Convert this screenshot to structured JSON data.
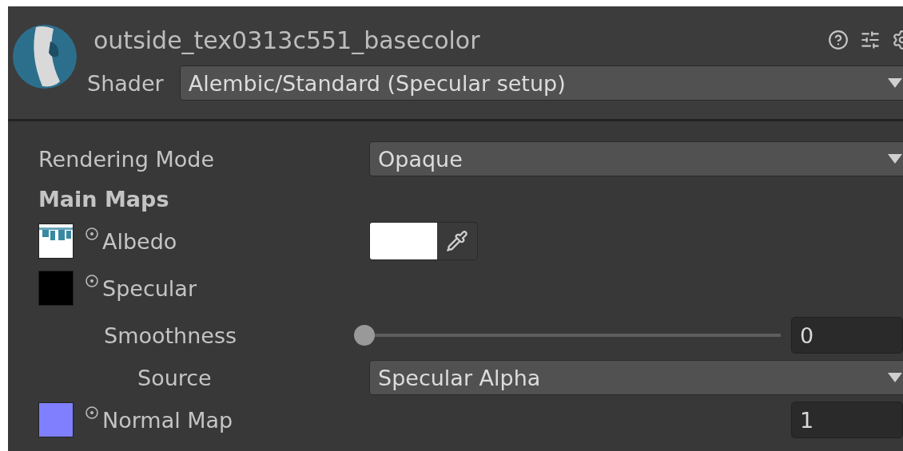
{
  "header": {
    "title": "outside_tex0313c551_basecolor",
    "shader_label": "Shader",
    "shader": "Alembic/Standard (Specular setup)"
  },
  "properties": [
    {
      "kind": "dropdown",
      "label": "Rendering Mode",
      "value": "Opaque"
    },
    {
      "kind": "section",
      "label": "Main Maps"
    },
    {
      "kind": "texture-color",
      "label": "Albedo",
      "color": "#ffffff"
    },
    {
      "kind": "texture",
      "label": "Specular",
      "thumbnail": {
        "kind": "solid",
        "color": "#000000"
      },
      "children": [
        {
          "kind": "slider",
          "label": "Smoothness",
          "level": 0,
          "value": "0",
          "children": [
            {
              "kind": "dropdown",
              "label": "Source",
              "value": "Specular Alpha"
            }
          ]
        }
      ]
    },
    {
      "kind": "texture-float",
      "label": "Normal Map",
      "thumbnail": {
        "kind": "solid",
        "color": "#8080ff"
      },
      "value": "1"
    }
  ]
}
